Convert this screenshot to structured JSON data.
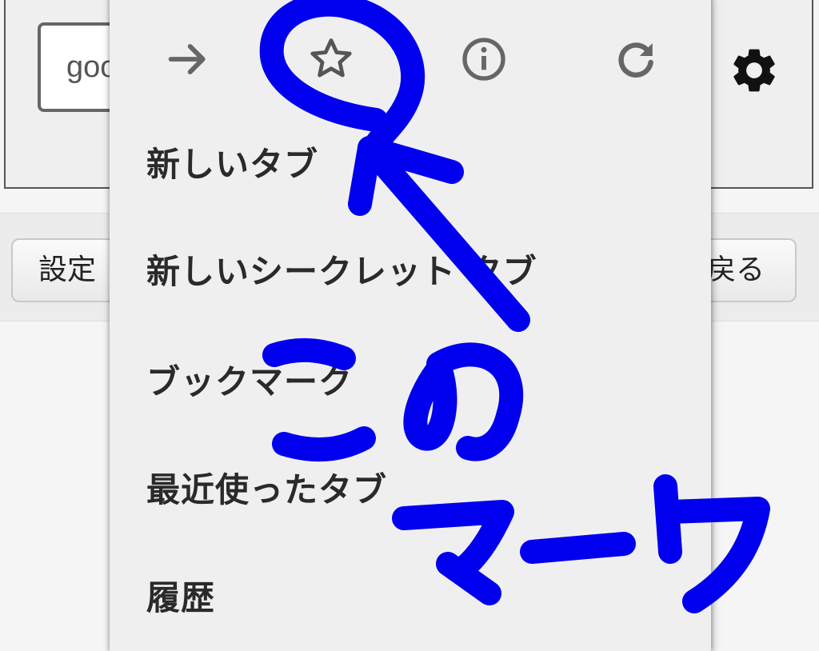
{
  "page": {
    "url_fragment": "goo",
    "buttons": {
      "settings": "設定",
      "back": "戻る"
    }
  },
  "menu": {
    "toolbar": [
      "forward-icon",
      "bookmark-star-icon",
      "info-icon",
      "reload-icon"
    ],
    "items": [
      {
        "label": "新しいタブ"
      },
      {
        "label": "新しいシークレット タブ"
      },
      {
        "label": "ブックマーク"
      },
      {
        "label": "最近使ったタブ"
      },
      {
        "label": "履歴"
      }
    ]
  },
  "annotation": {
    "color": "#0000ee",
    "text": "このマーク"
  },
  "colors": {
    "menu_bg": "#f0eff0",
    "icon": "#666666",
    "text": "#2a2a2a"
  }
}
